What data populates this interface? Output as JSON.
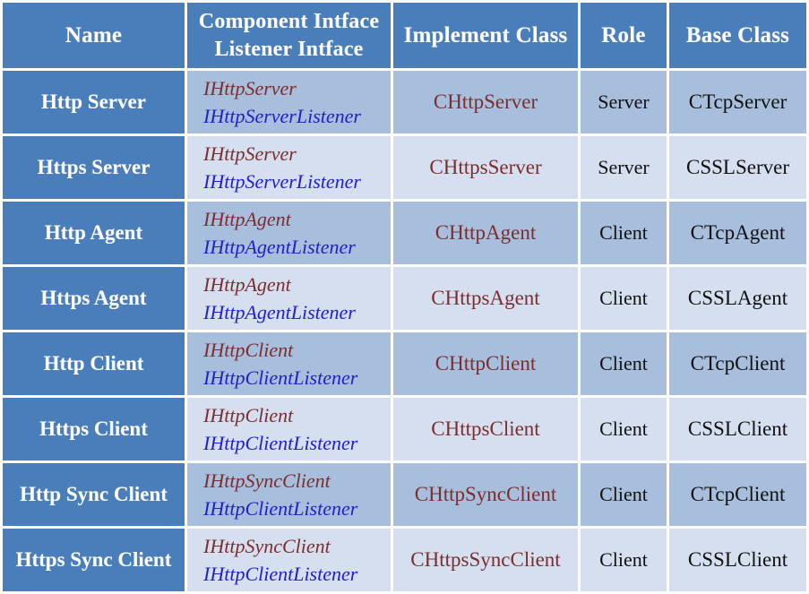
{
  "table": {
    "columns": [
      {
        "key": "name",
        "label": "Name",
        "label2": ""
      },
      {
        "key": "iface",
        "label": "Component Intface",
        "label2": "Listener Intface"
      },
      {
        "key": "impl",
        "label": "Implement Class",
        "label2": ""
      },
      {
        "key": "role",
        "label": "Role",
        "label2": ""
      },
      {
        "key": "base",
        "label": "Base Class",
        "label2": ""
      }
    ],
    "rows": [
      {
        "name": "Http Server",
        "component_intface": "IHttpServer",
        "listener_intface": "IHttpServerListener",
        "implement_class": "CHttpServer",
        "role": "Server",
        "base_class": "CTcpServer"
      },
      {
        "name": "Https Server",
        "component_intface": "IHttpServer",
        "listener_intface": "IHttpServerListener",
        "implement_class": "CHttpsServer",
        "role": "Server",
        "base_class": "CSSLServer"
      },
      {
        "name": "Http Agent",
        "component_intface": "IHttpAgent",
        "listener_intface": "IHttpAgentListener",
        "implement_class": "CHttpAgent",
        "role": "Client",
        "base_class": "CTcpAgent"
      },
      {
        "name": "Https Agent",
        "component_intface": "IHttpAgent",
        "listener_intface": "IHttpAgentListener",
        "implement_class": "CHttpsAgent",
        "role": "Client",
        "base_class": "CSSLAgent"
      },
      {
        "name": "Http Client",
        "component_intface": "IHttpClient",
        "listener_intface": "IHttpClientListener",
        "implement_class": "CHttpClient",
        "role": "Client",
        "base_class": "CTcpClient"
      },
      {
        "name": "Https Client",
        "component_intface": "IHttpClient",
        "listener_intface": "IHttpClientListener",
        "implement_class": "CHttpsClient",
        "role": "Client",
        "base_class": "CSSLClient"
      },
      {
        "name": "Http Sync Client",
        "component_intface": "IHttpSyncClient",
        "listener_intface": "IHttpClientListener",
        "implement_class": "CHttpSyncClient",
        "role": "Client",
        "base_class": "CTcpClient"
      },
      {
        "name": "Https Sync Client",
        "component_intface": "IHttpSyncClient",
        "listener_intface": "IHttpClientListener",
        "implement_class": "CHttpsSyncClient",
        "role": "Client",
        "base_class": "CSSLClient"
      }
    ]
  },
  "colors": {
    "header_bg": "#4a7ebb",
    "header_text": "#ffffff",
    "name_bg": "#4a7ebb",
    "row_dark_bg": "#a8bedd",
    "row_light_bg": "#d6dff0",
    "component_intface_text": "#7b2e2e",
    "listener_intface_text": "#2020cc",
    "implement_class_text": "#7b2e2e",
    "plain_text": "#111111",
    "page_bg": "#ffffff"
  }
}
